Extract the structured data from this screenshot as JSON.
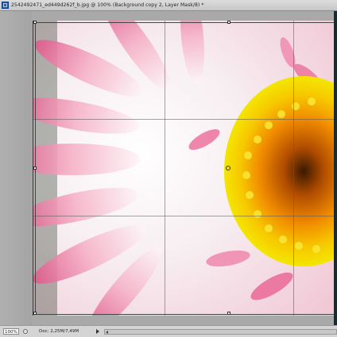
{
  "window": {
    "title": "2542492471_ed449d262f_b.jpg @ 100% (Background copy 2, Layer Mask/8) *"
  },
  "statusbar": {
    "zoom": "100%",
    "doc_info": "Doc: 2,25M/7,49M"
  },
  "colors": {
    "petal_pink": "#e86a98",
    "petal_white": "#faf2f4",
    "center_yellow": "#f3d400",
    "center_orange": "#e98a00"
  },
  "icons": {
    "app": "photoshop-document-icon",
    "status": "info-icon",
    "menu": "triangle-right-icon"
  }
}
